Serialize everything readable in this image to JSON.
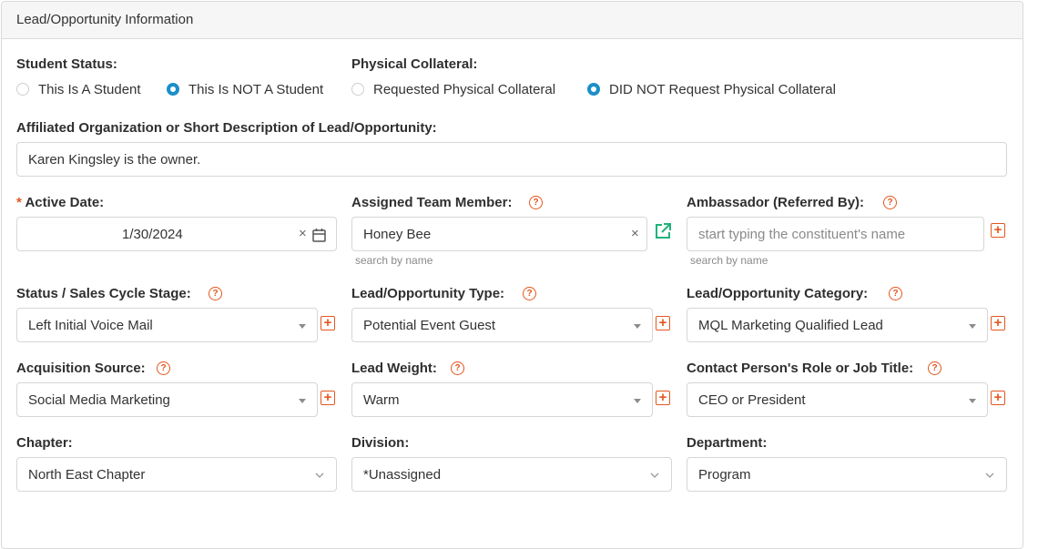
{
  "panel": {
    "title": "Lead/Opportunity Information"
  },
  "student_status": {
    "label": "Student Status:",
    "options": [
      {
        "label": "This Is A Student",
        "selected": false
      },
      {
        "label": "This Is NOT A Student",
        "selected": true
      }
    ]
  },
  "physical_collateral": {
    "label": "Physical Collateral:",
    "options": [
      {
        "label": "Requested Physical Collateral",
        "selected": false
      },
      {
        "label": "DID NOT Request Physical Collateral",
        "selected": true
      }
    ]
  },
  "affiliated": {
    "label": "Affiliated Organization or Short Description of Lead/Opportunity:",
    "value": "Karen Kingsley is the owner."
  },
  "active_date": {
    "required_mark": "*",
    "label": "Active Date:",
    "value": "1/30/2024",
    "clear": "×"
  },
  "assigned_team_member": {
    "label": "Assigned Team Member:",
    "value": "Honey Bee",
    "clear": "×",
    "hint": "search by name"
  },
  "ambassador": {
    "label": "Ambassador (Referred By):",
    "placeholder": "start typing the constituent's name",
    "hint": "search by name"
  },
  "status_stage": {
    "label": "Status / Sales Cycle Stage:",
    "value": "Left Initial Voice Mail"
  },
  "lead_type": {
    "label": "Lead/Opportunity Type:",
    "value": "Potential Event Guest"
  },
  "lead_category": {
    "label": "Lead/Opportunity Category:",
    "value": "MQL Marketing Qualified Lead"
  },
  "acquisition_source": {
    "label": "Acquisition Source:",
    "value": "Social Media Marketing"
  },
  "lead_weight": {
    "label": "Lead Weight:",
    "value": "Warm"
  },
  "contact_role": {
    "label": "Contact Person's Role or Job Title:",
    "value": "CEO or President"
  },
  "chapter": {
    "label": "Chapter:",
    "value": "North East Chapter"
  },
  "division": {
    "label": "Division:",
    "value": "*Unassigned"
  },
  "department": {
    "label": "Department:",
    "value": "Program"
  },
  "icons": {
    "help": "question-circle-icon",
    "add": "plus-square-icon",
    "calendar": "calendar-icon",
    "external": "external-link-icon",
    "dropdown": "chevron-down-icon"
  },
  "colors": {
    "accent": "#e4571f",
    "radio_selected": "#1b8fc9",
    "link_green": "#1fb37a"
  }
}
